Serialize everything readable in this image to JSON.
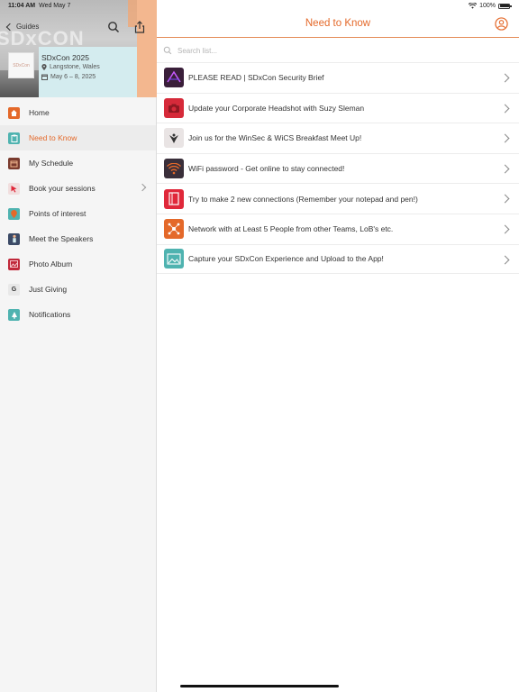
{
  "status_bar": {
    "time": "11:04 AM",
    "date": "Wed May 7",
    "battery": "100%"
  },
  "sidebar": {
    "back_label": "Guides",
    "hero_watermark": "SDxCON",
    "event": {
      "title": "SDxCon 2025",
      "location": "Langstone, Wales",
      "dates": "May 6 – 8, 2025"
    },
    "items": [
      {
        "label": "Home",
        "icon": "home-icon",
        "color": "#e4692a"
      },
      {
        "label": "Need to Know",
        "icon": "clipboard-icon",
        "color": "#4fb3b0",
        "active": true
      },
      {
        "label": "My Schedule",
        "icon": "calendar-icon",
        "color": "#7a3b2e"
      },
      {
        "label": "Book your sessions",
        "icon": "cursor-icon",
        "color": "#e0505a",
        "has_chevron": true
      },
      {
        "label": "Points of interest",
        "icon": "map-pin-icon",
        "color": "#4fb3b0"
      },
      {
        "label": "Meet the Speakers",
        "icon": "speaker-icon",
        "color": "#3b4a66"
      },
      {
        "label": "Photo Album",
        "icon": "photo-icon",
        "color": "#c0283a"
      },
      {
        "label": "Just Giving",
        "icon": "g-icon",
        "color": "#555555"
      },
      {
        "label": "Notifications",
        "icon": "bell-icon",
        "color": "#4fb3b0"
      }
    ]
  },
  "main": {
    "title": "Need to Know",
    "search_placeholder": "Search list...",
    "items": [
      {
        "label": "PLEASE READ | SDxCon Security Brief",
        "icon": "security-brief-icon",
        "color": "#3a1f3a"
      },
      {
        "label": "Update your Corporate Headshot with Suzy Sleman",
        "icon": "camera-icon",
        "color": "#d62a3a"
      },
      {
        "label": "Join us for the WinSec & WiCS Breakfast Meet Up!",
        "icon": "bird-icon",
        "color": "#e9e4e4"
      },
      {
        "label": "WiFi password - Get online to stay connected!",
        "icon": "wifi-icon",
        "color": "#3a2f3a"
      },
      {
        "label": "Try to make 2 new connections (Remember your notepad and pen!)",
        "icon": "notepad-icon",
        "color": "#e0283a"
      },
      {
        "label": "Network with at Least 5 People from other Teams, LoB's etc.",
        "icon": "network-icon",
        "color": "#e4692a"
      },
      {
        "label": "Capture your SDxCon Experience and Upload to the App!",
        "icon": "upload-photo-icon",
        "color": "#4fb3b0"
      }
    ]
  },
  "colors": {
    "accent": "#e4692a",
    "teal": "#4fb3b0"
  }
}
